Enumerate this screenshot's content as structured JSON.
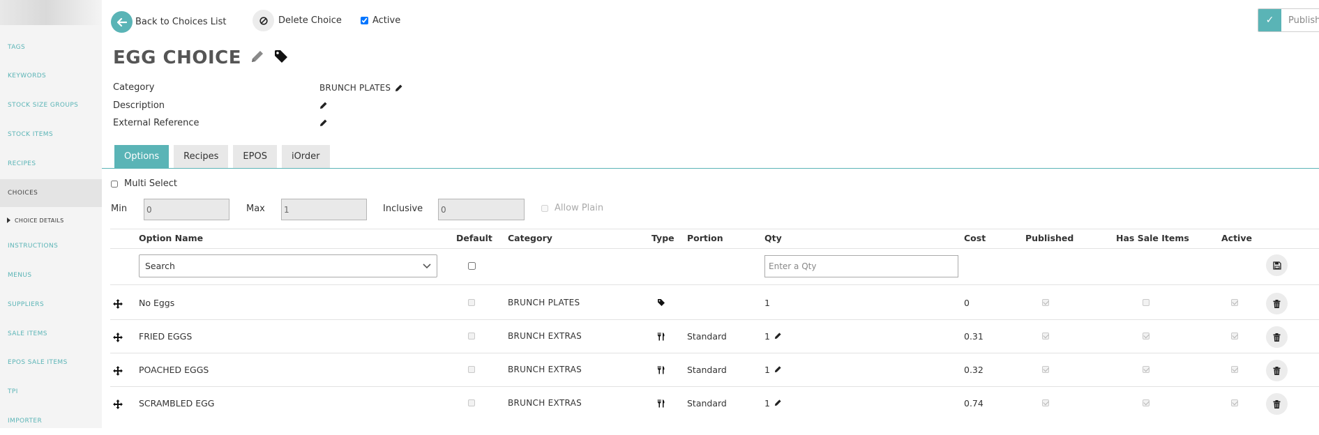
{
  "sidebar": {
    "items": [
      {
        "label": "TAGS"
      },
      {
        "label": "KEYWORDS"
      },
      {
        "label": "STOCK SIZE GROUPS"
      },
      {
        "label": "STOCK ITEMS"
      },
      {
        "label": "RECIPES"
      },
      {
        "label": "CHOICES"
      },
      {
        "label": "INSTRUCTIONS"
      },
      {
        "label": "MENUS"
      },
      {
        "label": "SUPPLIERS"
      },
      {
        "label": "SALE ITEMS"
      },
      {
        "label": "EPOS SALE ITEMS"
      },
      {
        "label": "TPI"
      },
      {
        "label": "IMPORTER"
      }
    ],
    "active_sub": "CHOICE DETAILS"
  },
  "topbar": {
    "back_label": "Back to Choices List",
    "delete_label": "Delete Choice",
    "active_label": "Active",
    "publish_label": "Publish"
  },
  "choice": {
    "title": "EGG CHOICE",
    "category_label": "Category",
    "category_value": "BRUNCH PLATES",
    "description_label": "Description",
    "external_ref_label": "External Reference"
  },
  "tabs": [
    {
      "label": "Options"
    },
    {
      "label": "Recipes"
    },
    {
      "label": "EPOS"
    },
    {
      "label": "iOrder"
    }
  ],
  "options": {
    "multi_select_label": "Multi Select",
    "min_label": "Min",
    "min_value": "0",
    "max_label": "Max",
    "max_value": "1",
    "inclusive_label": "Inclusive",
    "inclusive_value": "0",
    "allow_plain_label": "Allow Plain"
  },
  "table": {
    "headers": {
      "option_name": "Option Name",
      "default": "Default",
      "category": "Category",
      "type": "Type",
      "portion": "Portion",
      "qty": "Qty",
      "cost": "Cost",
      "published": "Published",
      "has_sale_items": "Has Sale Items",
      "active": "Active"
    },
    "search_placeholder": "Search",
    "qty_placeholder": "Enter a Qty",
    "rows": [
      {
        "name": "No Eggs",
        "category": "BRUNCH PLATES",
        "type_icon": "tag-icon",
        "portion": "",
        "qty": "1",
        "qty_editable": false,
        "cost": "0",
        "published": true,
        "has_sale_items": false,
        "active": true
      },
      {
        "name": "FRIED EGGS",
        "category": "BRUNCH EXTRAS",
        "type_icon": "utensils-icon",
        "portion": "Standard",
        "qty": "1",
        "qty_editable": true,
        "cost": "0.31",
        "published": true,
        "has_sale_items": true,
        "active": true
      },
      {
        "name": "POACHED EGGS",
        "category": "BRUNCH EXTRAS",
        "type_icon": "utensils-icon",
        "portion": "Standard",
        "qty": "1",
        "qty_editable": true,
        "cost": "0.32",
        "published": true,
        "has_sale_items": true,
        "active": true
      },
      {
        "name": "SCRAMBLED EGG",
        "category": "BRUNCH EXTRAS",
        "type_icon": "utensils-icon",
        "portion": "Standard",
        "qty": "1",
        "qty_editable": true,
        "cost": "0.74",
        "published": true,
        "has_sale_items": true,
        "active": true
      }
    ]
  },
  "colors": {
    "accent": "#5ab4b6",
    "sidebar_bg": "#f4f4f4"
  }
}
